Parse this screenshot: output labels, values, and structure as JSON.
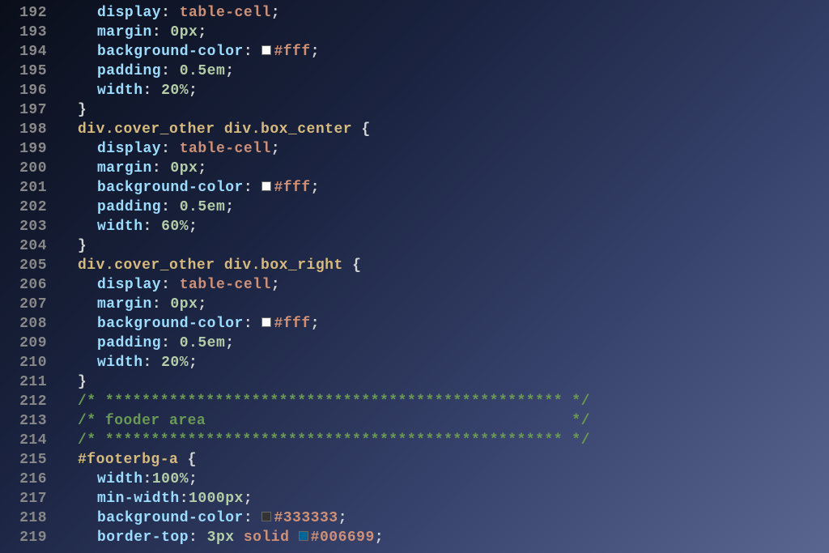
{
  "lineNumbers": [
    "192",
    "193",
    "194",
    "195",
    "196",
    "197",
    "198",
    "199",
    "200",
    "201",
    "202",
    "203",
    "204",
    "205",
    "206",
    "207",
    "208",
    "209",
    "210",
    "211",
    "212",
    "213",
    "214",
    "215",
    "216",
    "217",
    "218",
    "219"
  ],
  "lines": {
    "192": {
      "indent": 2,
      "tokens": [
        {
          "t": "prop",
          "v": "display"
        },
        {
          "t": "punct",
          "v": ": "
        },
        {
          "t": "val",
          "v": "table-cell"
        },
        {
          "t": "punct",
          "v": ";"
        }
      ]
    },
    "193": {
      "indent": 2,
      "tokens": [
        {
          "t": "prop",
          "v": "margin"
        },
        {
          "t": "punct",
          "v": ": "
        },
        {
          "t": "num",
          "v": "0px"
        },
        {
          "t": "punct",
          "v": ";"
        }
      ]
    },
    "194": {
      "indent": 2,
      "tokens": [
        {
          "t": "prop",
          "v": "background-color"
        },
        {
          "t": "punct",
          "v": ": "
        },
        {
          "t": "swatch",
          "v": "#fff"
        },
        {
          "t": "hex",
          "v": "#fff"
        },
        {
          "t": "punct",
          "v": ";"
        }
      ]
    },
    "195": {
      "indent": 2,
      "tokens": [
        {
          "t": "prop",
          "v": "padding"
        },
        {
          "t": "punct",
          "v": ": "
        },
        {
          "t": "num",
          "v": "0.5em"
        },
        {
          "t": "punct",
          "v": ";"
        }
      ]
    },
    "196": {
      "indent": 2,
      "tokens": [
        {
          "t": "prop",
          "v": "width"
        },
        {
          "t": "punct",
          "v": ": "
        },
        {
          "t": "num",
          "v": "20%"
        },
        {
          "t": "punct",
          "v": ";"
        }
      ]
    },
    "197": {
      "indent": 1,
      "tokens": [
        {
          "t": "punct",
          "v": "}"
        }
      ]
    },
    "198": {
      "indent": 1,
      "tokens": [
        {
          "t": "sel",
          "v": "div.cover_other div.box_center "
        },
        {
          "t": "punct",
          "v": "{"
        }
      ]
    },
    "199": {
      "indent": 2,
      "tokens": [
        {
          "t": "prop",
          "v": "display"
        },
        {
          "t": "punct",
          "v": ": "
        },
        {
          "t": "val",
          "v": "table-cell"
        },
        {
          "t": "punct",
          "v": ";"
        }
      ]
    },
    "200": {
      "indent": 2,
      "tokens": [
        {
          "t": "prop",
          "v": "margin"
        },
        {
          "t": "punct",
          "v": ": "
        },
        {
          "t": "num",
          "v": "0px"
        },
        {
          "t": "punct",
          "v": ";"
        }
      ]
    },
    "201": {
      "indent": 2,
      "tokens": [
        {
          "t": "prop",
          "v": "background-color"
        },
        {
          "t": "punct",
          "v": ": "
        },
        {
          "t": "swatch",
          "v": "#fff"
        },
        {
          "t": "hex",
          "v": "#fff"
        },
        {
          "t": "punct",
          "v": ";"
        }
      ]
    },
    "202": {
      "indent": 2,
      "tokens": [
        {
          "t": "prop",
          "v": "padding"
        },
        {
          "t": "punct",
          "v": ": "
        },
        {
          "t": "num",
          "v": "0.5em"
        },
        {
          "t": "punct",
          "v": ";"
        }
      ]
    },
    "203": {
      "indent": 2,
      "tokens": [
        {
          "t": "prop",
          "v": "width"
        },
        {
          "t": "punct",
          "v": ": "
        },
        {
          "t": "num",
          "v": "60%"
        },
        {
          "t": "punct",
          "v": ";"
        }
      ]
    },
    "204": {
      "indent": 1,
      "tokens": [
        {
          "t": "punct",
          "v": "}"
        }
      ]
    },
    "205": {
      "indent": 1,
      "tokens": [
        {
          "t": "sel",
          "v": "div.cover_other div.box_right "
        },
        {
          "t": "punct",
          "v": "{"
        }
      ]
    },
    "206": {
      "indent": 2,
      "tokens": [
        {
          "t": "prop",
          "v": "display"
        },
        {
          "t": "punct",
          "v": ": "
        },
        {
          "t": "val",
          "v": "table-cell"
        },
        {
          "t": "punct",
          "v": ";"
        }
      ]
    },
    "207": {
      "indent": 2,
      "tokens": [
        {
          "t": "prop",
          "v": "margin"
        },
        {
          "t": "punct",
          "v": ": "
        },
        {
          "t": "num",
          "v": "0px"
        },
        {
          "t": "punct",
          "v": ";"
        }
      ]
    },
    "208": {
      "indent": 2,
      "tokens": [
        {
          "t": "prop",
          "v": "background-color"
        },
        {
          "t": "punct",
          "v": ": "
        },
        {
          "t": "swatch",
          "v": "#fff"
        },
        {
          "t": "hex",
          "v": "#fff"
        },
        {
          "t": "punct",
          "v": ";"
        }
      ]
    },
    "209": {
      "indent": 2,
      "tokens": [
        {
          "t": "prop",
          "v": "padding"
        },
        {
          "t": "punct",
          "v": ": "
        },
        {
          "t": "num",
          "v": "0.5em"
        },
        {
          "t": "punct",
          "v": ";"
        }
      ]
    },
    "210": {
      "indent": 2,
      "tokens": [
        {
          "t": "prop",
          "v": "width"
        },
        {
          "t": "punct",
          "v": ": "
        },
        {
          "t": "num",
          "v": "20%"
        },
        {
          "t": "punct",
          "v": ";"
        }
      ]
    },
    "211": {
      "indent": 1,
      "tokens": [
        {
          "t": "punct",
          "v": "}"
        }
      ]
    },
    "212": {
      "indent": 1,
      "tokens": [
        {
          "t": "comment",
          "v": "/* ************************************************** */"
        }
      ]
    },
    "213": {
      "indent": 1,
      "tokens": [
        {
          "t": "comment",
          "v": "/* fooder area                                        */"
        }
      ]
    },
    "214": {
      "indent": 1,
      "tokens": [
        {
          "t": "comment",
          "v": "/* ************************************************** */"
        }
      ]
    },
    "215": {
      "indent": 1,
      "tokens": [
        {
          "t": "id",
          "v": "#footerbg-a "
        },
        {
          "t": "punct",
          "v": "{"
        }
      ]
    },
    "216": {
      "indent": 2,
      "tokens": [
        {
          "t": "prop",
          "v": "width"
        },
        {
          "t": "punct",
          "v": ":"
        },
        {
          "t": "num",
          "v": "100%"
        },
        {
          "t": "punct",
          "v": ";"
        }
      ]
    },
    "217": {
      "indent": 2,
      "tokens": [
        {
          "t": "prop",
          "v": "min-width"
        },
        {
          "t": "punct",
          "v": ":"
        },
        {
          "t": "num",
          "v": "1000px"
        },
        {
          "t": "punct",
          "v": ";"
        }
      ]
    },
    "218": {
      "indent": 2,
      "tokens": [
        {
          "t": "prop",
          "v": "background-color"
        },
        {
          "t": "punct",
          "v": ": "
        },
        {
          "t": "swatch",
          "v": "#333333"
        },
        {
          "t": "hex",
          "v": "#333333"
        },
        {
          "t": "punct",
          "v": ";"
        }
      ]
    },
    "219": {
      "indent": 2,
      "tokens": [
        {
          "t": "prop",
          "v": "border-top"
        },
        {
          "t": "punct",
          "v": ": "
        },
        {
          "t": "num",
          "v": "3px "
        },
        {
          "t": "val",
          "v": "solid "
        },
        {
          "t": "swatch",
          "v": "#006699"
        },
        {
          "t": "hex",
          "v": "#006699"
        },
        {
          "t": "punct",
          "v": ";"
        }
      ]
    }
  }
}
